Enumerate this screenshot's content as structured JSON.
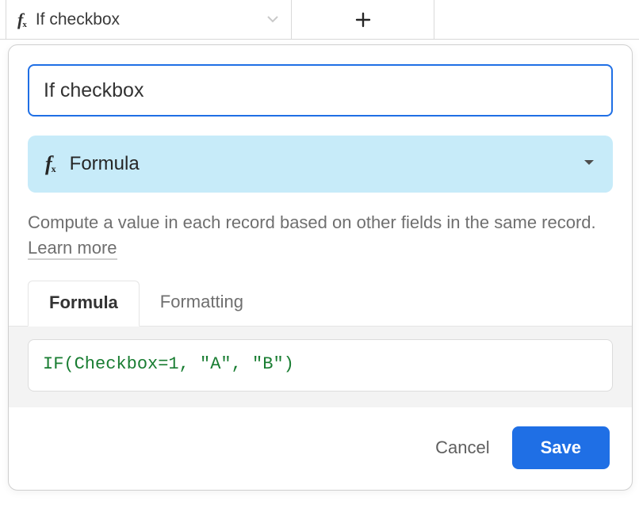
{
  "header": {
    "column_name": "If checkbox"
  },
  "panel": {
    "field_name_value": "If checkbox",
    "field_type": "Formula",
    "description_pre": "Compute a value in each record based on other fields in the same record. ",
    "learn_more_label": "Learn more",
    "tabs": [
      {
        "label": "Formula",
        "active": true
      },
      {
        "label": "Formatting",
        "active": false
      }
    ],
    "formula": "IF(Checkbox=1, \"A\", \"B\")",
    "buttons": {
      "cancel": "Cancel",
      "save": "Save"
    }
  }
}
